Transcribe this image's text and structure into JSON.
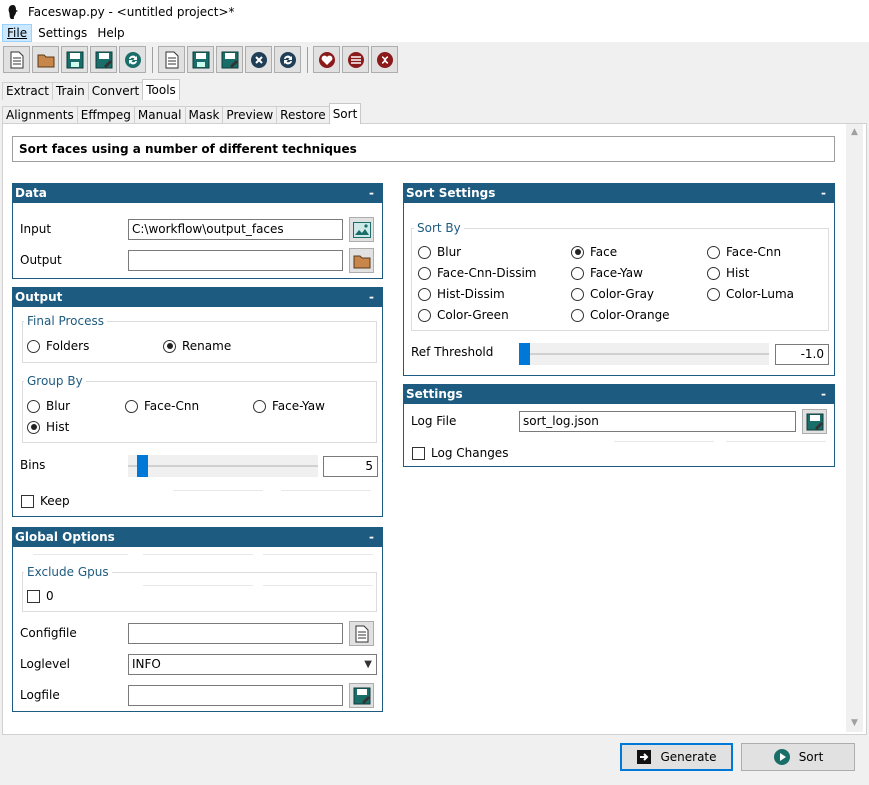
{
  "window": {
    "title": "Faceswap.py - <untitled project>*"
  },
  "menu": {
    "file": "File",
    "settings": "Settings",
    "help": "Help"
  },
  "tabs": {
    "main": [
      "Extract",
      "Train",
      "Convert",
      "Tools"
    ],
    "sub": [
      "Alignments",
      "Effmpeg",
      "Manual",
      "Mask",
      "Preview",
      "Restore",
      "Sort"
    ]
  },
  "description": "Sort faces using a number of different techniques",
  "data_panel": {
    "title": "Data",
    "collapse": "-",
    "input_label": "Input",
    "input_value": "C:\\workflow\\output_faces",
    "output_label": "Output",
    "output_value": ""
  },
  "output_panel": {
    "title": "Output",
    "collapse": "-",
    "final_process": {
      "title": "Final Process",
      "options": [
        "Folders",
        "Rename"
      ],
      "selected": "Rename"
    },
    "group_by": {
      "title": "Group By",
      "options": [
        "Blur",
        "Face-Cnn",
        "Face-Yaw",
        "Hist"
      ],
      "selected": "Hist"
    },
    "bins_label": "Bins",
    "bins_value": "5",
    "bins_level": 0.05,
    "keep_label": "Keep"
  },
  "global_panel": {
    "title": "Global Options",
    "collapse": "-",
    "exclude_gpus": {
      "title": "Exclude Gpus",
      "option": "0"
    },
    "configfile_label": "Configfile",
    "configfile_value": "",
    "loglevel_label": "Loglevel",
    "loglevel_value": "INFO",
    "logfile_label": "Logfile",
    "logfile_value": ""
  },
  "sort_panel": {
    "title": "Sort Settings",
    "collapse": "-",
    "sort_by": {
      "title": "Sort By",
      "options": [
        "Blur",
        "Face",
        "Face-Cnn",
        "Face-Cnn-Dissim",
        "Face-Yaw",
        "Hist",
        "Hist-Dissim",
        "Color-Gray",
        "Color-Luma",
        "Color-Green",
        "Color-Orange"
      ],
      "selected": "Face"
    },
    "ref_label": "Ref Threshold",
    "ref_value": "-1.0",
    "ref_level": 0.0
  },
  "settings_panel": {
    "title": "Settings",
    "collapse": "-",
    "log_file_label": "Log File",
    "log_file_value": "sort_log.json",
    "log_changes_label": "Log Changes"
  },
  "buttons": {
    "generate": "Generate",
    "sort": "Sort"
  },
  "colors": {
    "panel_header": "#1e5b80",
    "slider_thumb": "#0078d7",
    "group_title": "#1e5b80"
  }
}
